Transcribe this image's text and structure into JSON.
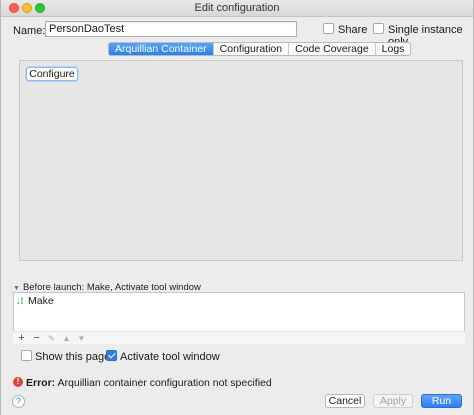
{
  "window": {
    "title": "Edit configuration"
  },
  "form": {
    "name_label": "Name:",
    "name_value": "PersonDaoTest",
    "share_label": "Share",
    "share_checked": false,
    "single_instance_label": "Single instance only",
    "single_instance_checked": false
  },
  "tabs": [
    {
      "label": "Arquillian Container",
      "active": true
    },
    {
      "label": "Configuration",
      "active": false
    },
    {
      "label": "Code Coverage",
      "active": false
    },
    {
      "label": "Logs",
      "active": false
    }
  ],
  "panel": {
    "configure_label": "Configure"
  },
  "before_launch": {
    "header": "Before launch: Make, Activate tool window",
    "items": [
      {
        "label": "Make",
        "icon": "make-icon"
      }
    ],
    "toolbar": [
      "add-icon",
      "remove-icon",
      "edit-icon",
      "move-up-icon",
      "move-down-icon"
    ]
  },
  "options": {
    "show_page_label": "Show this page",
    "show_page_checked": false,
    "activate_tool_label": "Activate tool window",
    "activate_tool_checked": true
  },
  "error": {
    "prefix": "Error:",
    "message": " Arquillian container configuration not specified",
    "color": "#d9463e"
  },
  "buttons": {
    "help": "?",
    "cancel": "Cancel",
    "apply": "Apply",
    "run": "Run"
  },
  "colors": {
    "accent": "#2f7de1"
  }
}
